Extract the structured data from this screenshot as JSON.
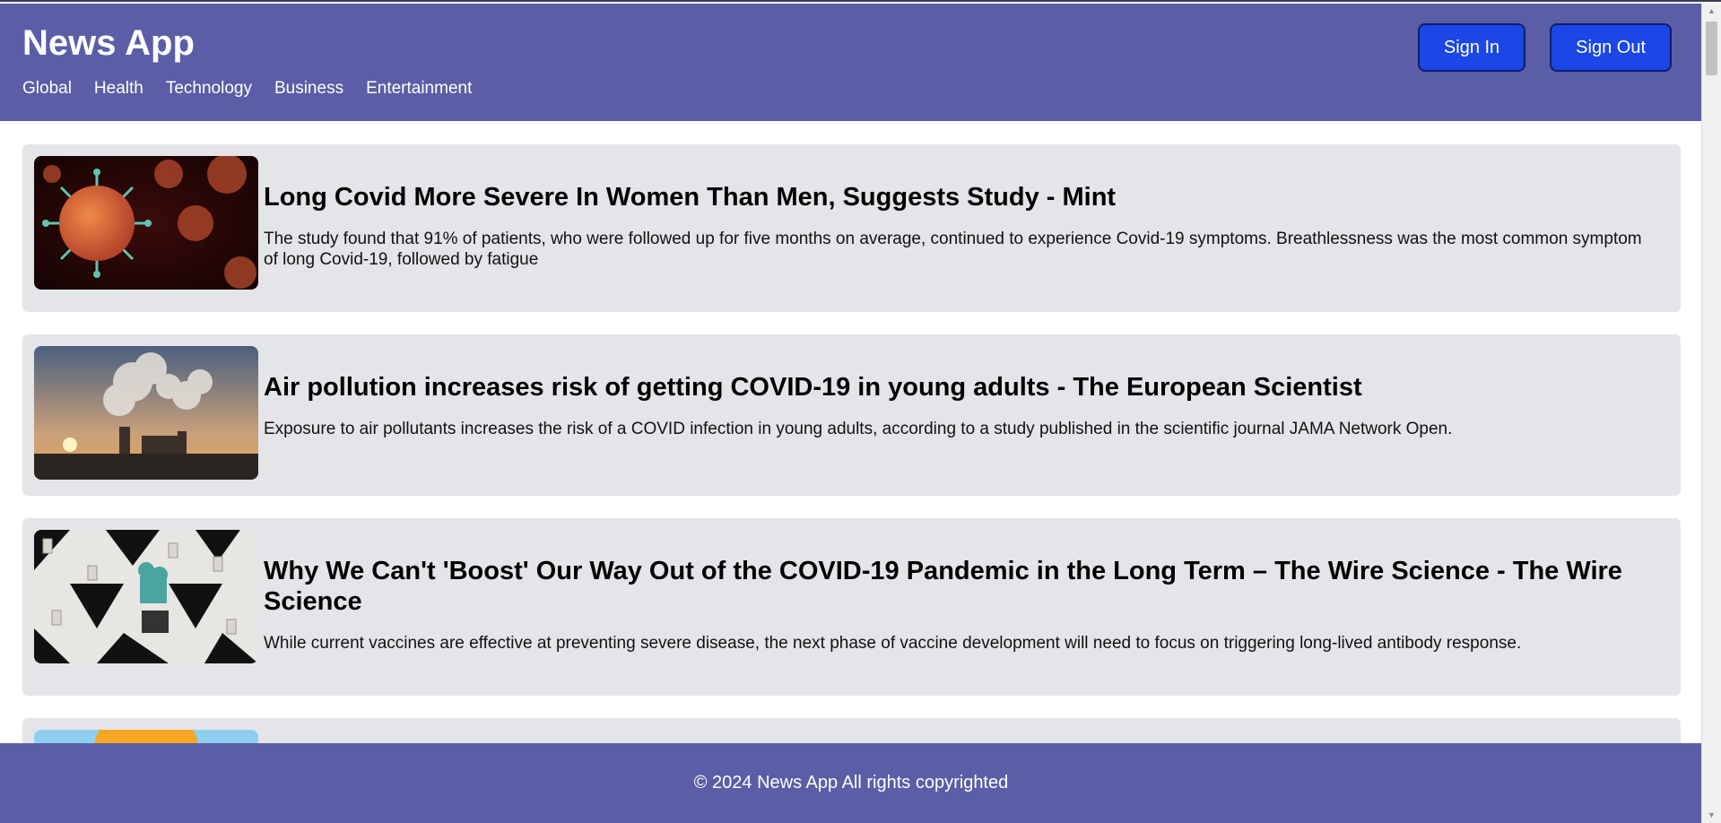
{
  "app": {
    "title": "News App"
  },
  "nav": {
    "items": [
      "Global",
      "Health",
      "Technology",
      "Business",
      "Entertainment"
    ]
  },
  "auth": {
    "sign_in": "Sign In",
    "sign_out": "Sign Out"
  },
  "articles": [
    {
      "title": "Long Covid More Severe In Women Than Men, Suggests Study - Mint",
      "description": "The study found that 91% of patients, who were followed up for five months on average, continued to experience Covid-19 symptoms. Breathlessness was the most common symptom of long Covid-19, followed by fatigue",
      "image_icon": "virus-image"
    },
    {
      "title": "Air pollution increases risk of getting COVID-19 in young adults - The European Scientist",
      "description": "Exposure to air pollutants increases the risk of a COVID infection in young adults, according to a study published in the scientific journal JAMA Network Open.",
      "image_icon": "factory-smoke-image"
    },
    {
      "title": "Why We Can't 'Boost' Our Way Out of the COVID-19 Pandemic in the Long Term – The Wire Science - The Wire Science",
      "description": "While current vaccines are effective at preventing severe disease, the next phase of vaccine development will need to focus on triggering long-lived antibody response.",
      "image_icon": "vaccination-center-image"
    }
  ],
  "footer": {
    "text": "© 2024 News App All rights copyrighted"
  },
  "colors": {
    "header_bg": "#5b5ea6",
    "button_bg": "#1a47e5",
    "card_bg": "#e4e5e9"
  }
}
